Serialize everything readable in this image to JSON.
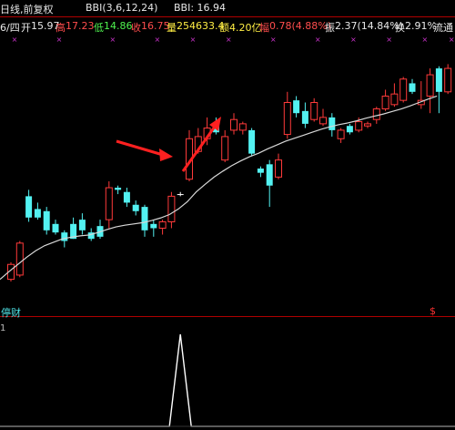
{
  "header": {
    "title": "日线,前复权",
    "indicator_name": "BBI(3,6,12,24)",
    "indicator_value_label": "BBI: 16.94"
  },
  "info": {
    "date": "6/四",
    "open_label": "开",
    "open": "15.97",
    "high_label": "高",
    "high": "17.23",
    "low_label": "低",
    "low": "14.86",
    "close_label": "收",
    "close": "16.75",
    "volume_label": "量",
    "volume": "254633.4",
    "amount_label": "额",
    "amount": "4.20亿",
    "change_label": "幅",
    "change": "0.78(4.88%)",
    "amplitude_label": "振",
    "amplitude": "2.37(14.84%)",
    "turnover_label": "换",
    "turnover": "2.91%",
    "tradable_label": "流通"
  },
  "indicator_panel": {
    "label": "停财",
    "signal_mark": "$",
    "value": "1"
  },
  "colors": {
    "up": "#ff3a3a",
    "down": "#53f2f2",
    "bbi_line": "#d8d8d8",
    "arrow": "#ff2020",
    "axis_red": "#c00000",
    "marker": "#cc33cc",
    "background": "#000000"
  },
  "chart_data": {
    "type": "candlestick",
    "candles": [
      {
        "dir": "up",
        "open": 14.9,
        "close": 15.25,
        "high": 15.3,
        "low": 14.85
      },
      {
        "dir": "up",
        "open": 15.0,
        "close": 15.75,
        "high": 15.8,
        "low": 14.95
      },
      {
        "dir": "down",
        "open": 16.85,
        "close": 16.35,
        "high": 17.0,
        "low": 16.25
      },
      {
        "dir": "down",
        "open": 16.55,
        "close": 16.35,
        "high": 16.7,
        "low": 16.3
      },
      {
        "dir": "down",
        "open": 16.5,
        "close": 16.05,
        "high": 16.6,
        "low": 15.95
      },
      {
        "dir": "down",
        "open": 16.2,
        "close": 16.0,
        "high": 16.3,
        "low": 15.95
      },
      {
        "dir": "down",
        "open": 16.0,
        "close": 15.8,
        "high": 16.05,
        "low": 15.65
      },
      {
        "dir": "down",
        "open": 16.2,
        "close": 15.85,
        "high": 16.35,
        "low": 15.85
      },
      {
        "dir": "down",
        "open": 16.3,
        "close": 16.05,
        "high": 16.45,
        "low": 15.95
      },
      {
        "dir": "down",
        "open": 16.0,
        "close": 15.85,
        "high": 16.1,
        "low": 15.8
      },
      {
        "dir": "down",
        "open": 16.15,
        "close": 15.9,
        "high": 16.3,
        "low": 15.85
      },
      {
        "dir": "up",
        "open": 16.3,
        "close": 17.05,
        "high": 17.2,
        "low": 16.1
      },
      {
        "dir": "down",
        "open": 17.05,
        "close": 17.0,
        "high": 17.1,
        "low": 16.9
      },
      {
        "dir": "down",
        "open": 16.95,
        "close": 16.7,
        "high": 17.05,
        "low": 16.6
      },
      {
        "dir": "down",
        "open": 16.65,
        "close": 16.5,
        "high": 16.75,
        "low": 16.4
      },
      {
        "dir": "down",
        "open": 16.6,
        "close": 16.05,
        "high": 16.65,
        "low": 15.9
      },
      {
        "dir": "down",
        "open": 16.2,
        "close": 16.1,
        "high": 16.3,
        "low": 15.9
      },
      {
        "dir": "up",
        "open": 16.1,
        "close": 16.25,
        "high": 16.3,
        "low": 15.95
      },
      {
        "dir": "up",
        "open": 16.25,
        "close": 16.85,
        "high": 16.95,
        "low": 16.1
      },
      {
        "dir": "none",
        "open": 16.9,
        "close": 16.9,
        "high": 16.95,
        "low": 16.85
      },
      {
        "dir": "up",
        "open": 17.25,
        "close": 18.2,
        "high": 18.4,
        "low": 17.2
      },
      {
        "dir": "up",
        "open": 17.9,
        "close": 18.25,
        "high": 18.45,
        "low": 17.85
      },
      {
        "dir": "up",
        "open": 18.2,
        "close": 18.45,
        "high": 18.7,
        "low": 18.05
      },
      {
        "dir": "down",
        "open": 18.55,
        "close": 18.35,
        "high": 18.7,
        "low": 18.3
      },
      {
        "dir": "up",
        "open": 17.7,
        "close": 18.25,
        "high": 18.4,
        "low": 17.65
      },
      {
        "dir": "up",
        "open": 18.4,
        "close": 18.65,
        "high": 18.8,
        "low": 18.3
      },
      {
        "dir": "up",
        "open": 18.4,
        "close": 18.55,
        "high": 18.6,
        "low": 18.3
      },
      {
        "dir": "down",
        "open": 18.4,
        "close": 17.85,
        "high": 18.45,
        "low": 17.8
      },
      {
        "dir": "down",
        "open": 17.5,
        "close": 17.4,
        "high": 17.55,
        "low": 17.3
      },
      {
        "dir": "down",
        "open": 17.6,
        "close": 17.1,
        "high": 17.7,
        "low": 16.6
      },
      {
        "dir": "up",
        "open": 17.3,
        "close": 17.7,
        "high": 17.85,
        "low": 17.25
      },
      {
        "dir": "up",
        "open": 18.3,
        "close": 19.05,
        "high": 19.3,
        "low": 18.2
      },
      {
        "dir": "down",
        "open": 19.1,
        "close": 18.8,
        "high": 19.2,
        "low": 18.7
      },
      {
        "dir": "down",
        "open": 18.85,
        "close": 18.55,
        "high": 19.05,
        "low": 18.45
      },
      {
        "dir": "up",
        "open": 18.65,
        "close": 19.05,
        "high": 19.15,
        "low": 18.6
      },
      {
        "dir": "up",
        "open": 18.55,
        "close": 18.7,
        "high": 18.9,
        "low": 18.5
      },
      {
        "dir": "down",
        "open": 18.7,
        "close": 18.4,
        "high": 18.8,
        "low": 18.25
      },
      {
        "dir": "up",
        "open": 18.2,
        "close": 18.4,
        "high": 18.45,
        "low": 18.1
      },
      {
        "dir": "down",
        "open": 18.5,
        "close": 18.35,
        "high": 18.55,
        "low": 18.3
      },
      {
        "dir": "up",
        "open": 18.4,
        "close": 18.6,
        "high": 18.7,
        "low": 18.35
      },
      {
        "dir": "up",
        "open": 18.5,
        "close": 18.55,
        "high": 18.6,
        "low": 18.45
      },
      {
        "dir": "up",
        "open": 18.65,
        "close": 18.9,
        "high": 18.95,
        "low": 18.55
      },
      {
        "dir": "up",
        "open": 18.9,
        "close": 19.2,
        "high": 19.35,
        "low": 18.85
      },
      {
        "dir": "up",
        "open": 19.0,
        "close": 19.25,
        "high": 19.5,
        "low": 18.95
      },
      {
        "dir": "up",
        "open": 19.1,
        "close": 19.6,
        "high": 19.65,
        "low": 19.05
      },
      {
        "dir": "down",
        "open": 19.5,
        "close": 19.3,
        "high": 19.6,
        "low": 19.25
      },
      {
        "dir": "up",
        "open": 19.0,
        "close": 19.1,
        "high": 19.55,
        "low": 18.9
      },
      {
        "dir": "up",
        "open": 19.2,
        "close": 19.7,
        "high": 19.85,
        "low": 18.8
      },
      {
        "dir": "down",
        "open": 19.85,
        "close": 19.3,
        "high": 19.9,
        "low": 18.8
      },
      {
        "dir": "up",
        "open": 19.3,
        "close": 19.85,
        "high": 19.95,
        "low": 19.25
      }
    ],
    "bbi": [
      14.9,
      15.08,
      15.25,
      15.42,
      15.57,
      15.69,
      15.77,
      15.85,
      15.89,
      15.92,
      15.94,
      16.0,
      16.07,
      16.13,
      16.17,
      16.2,
      16.23,
      16.28,
      16.34,
      16.42,
      16.55,
      16.72,
      16.95,
      17.13,
      17.3,
      17.44,
      17.57,
      17.68,
      17.78,
      17.86,
      17.96,
      18.05,
      18.14,
      18.21,
      18.28,
      18.35,
      18.42,
      18.48,
      18.53,
      18.57,
      18.62,
      18.68,
      18.73,
      18.78,
      18.84,
      18.9,
      18.97,
      19.05,
      19.13,
      19.2
    ],
    "signal_marker_indices": [
      0,
      5,
      11,
      16,
      20,
      24,
      29,
      34,
      38,
      42,
      46,
      49
    ],
    "indicator_series": {
      "type": "line",
      "x_index_range": [
        0,
        49
      ],
      "peak_index": 19,
      "peak_value": 1,
      "values_baseline": 0
    },
    "ylim": [
      14.4,
      20.6
    ]
  }
}
